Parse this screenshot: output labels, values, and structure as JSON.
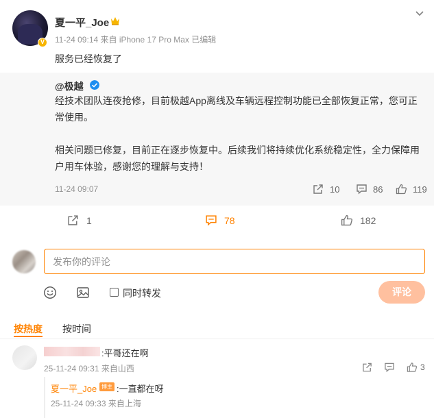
{
  "post": {
    "author": "夏一平_Joe",
    "meta": "11-24 09:14  来自 iPhone 17 Pro Max 已编辑",
    "text": "服务已经恢复了"
  },
  "quoted": {
    "user": "@极越",
    "paragraph1_line1": "经技术团队连夜抢修，目前极越App离线及车辆远程控制功能已全部恢复正常，您可正",
    "paragraph1_line2": "常使用。",
    "paragraph2_line1": "相关问题已修复，目前正在逐步恢复中。后续我们将持续优化系统稳定性，全力保障用",
    "paragraph2_line2": "户用车体验，感谢您的理解与支持！",
    "time": "11-24 09:07",
    "reposts": "10",
    "comments": "86",
    "likes": "119"
  },
  "actions": {
    "reposts": "1",
    "comments": "78",
    "likes": "182"
  },
  "comment_box": {
    "placeholder": "发布你的评论",
    "repost_label": "同时转发",
    "submit_label": "评论"
  },
  "sort": {
    "hot_label": "按热度",
    "time_label": "按时间"
  },
  "comments": [
    {
      "text": ":平哥还在啊",
      "time": "25-11-24 09:31 来自山西",
      "like_count": "3",
      "reply": {
        "author": "夏一平_Joe",
        "badge": "博主",
        "text": ":一直都在呀",
        "time": "25-11-24 09:33 来自上海"
      }
    }
  ],
  "colors": {
    "accent": "#ff8200",
    "submit_disabled": "#ffc09f",
    "verified_gold": "#f7b500",
    "verified_blue": "#1e8ef0"
  }
}
